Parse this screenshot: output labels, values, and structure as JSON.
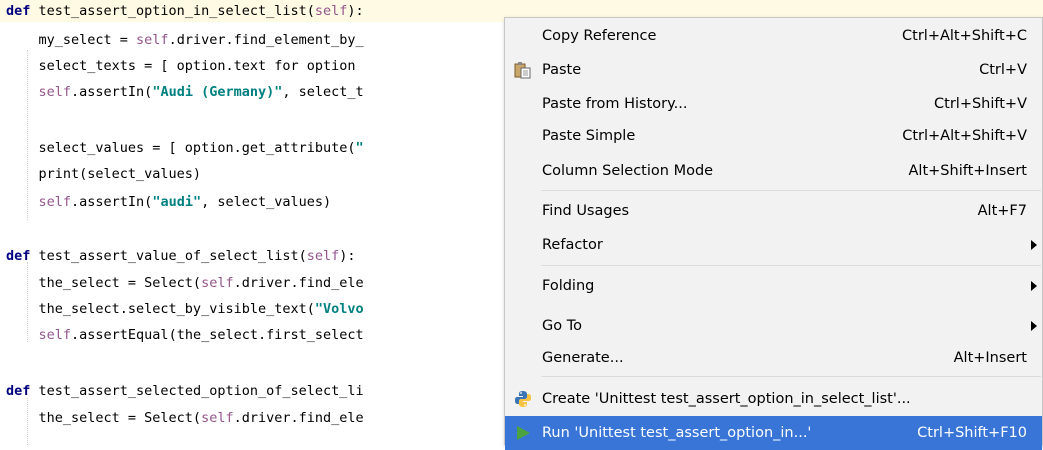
{
  "editor": {
    "lines": [
      [
        [
          "kw",
          "def "
        ],
        [
          "",
          "test_assert_option_in_select_list("
        ],
        [
          "self",
          "self"
        ],
        [
          "",
          "):"
        ]
      ],
      [
        [
          "",
          "    my_select = "
        ],
        [
          "self",
          "self"
        ],
        [
          "",
          ".driver.find_element_by_"
        ]
      ],
      [
        [
          "",
          "    select_texts = [ option.text for option "
        ]
      ],
      [
        [
          "",
          "    "
        ],
        [
          "self",
          "self"
        ],
        [
          "",
          ".assertIn("
        ],
        [
          "str",
          "\"Audi (Germany)\""
        ],
        [
          "",
          ", select_t"
        ]
      ],
      [],
      [
        [
          "",
          "    select_values = [ option.get_attribute("
        ],
        [
          "str",
          "\""
        ]
      ],
      [
        [
          "",
          "    print(select_values)"
        ]
      ],
      [
        [
          "",
          "    "
        ],
        [
          "self",
          "self"
        ],
        [
          "",
          ".assertIn("
        ],
        [
          "str",
          "\"audi\""
        ],
        [
          "",
          ", select_values)"
        ]
      ],
      [],
      [
        [
          "kw",
          "def "
        ],
        [
          "",
          "test_assert_value_of_select_list("
        ],
        [
          "self",
          "self"
        ],
        [
          "",
          "):"
        ]
      ],
      [
        [
          "",
          "    the_select = Select("
        ],
        [
          "self",
          "self"
        ],
        [
          "",
          ".driver.find_ele"
        ]
      ],
      [
        [
          "",
          "    the_select.select_by_visible_text("
        ],
        [
          "str",
          "\"Volvo"
        ]
      ],
      [
        [
          "",
          "    "
        ],
        [
          "self",
          "self"
        ],
        [
          "",
          ".assertEqual(the_select.first_select"
        ]
      ],
      [],
      [
        [
          "kw",
          "def "
        ],
        [
          "",
          "test_assert_selected_option_of_select_li"
        ]
      ],
      [
        [
          "",
          "    the_select = Select("
        ],
        [
          "self",
          "self"
        ],
        [
          "",
          ".driver.find_ele"
        ]
      ]
    ]
  },
  "menu": {
    "items": [
      {
        "name": "copy-reference-item",
        "label": "Copy Reference",
        "shortcut": "Ctrl+Alt+Shift+C"
      },
      {
        "name": "paste-item",
        "label": "Paste",
        "shortcut": "Ctrl+V",
        "icon": "paste-icon"
      },
      {
        "name": "paste-from-history-item",
        "label": "Paste from History...",
        "shortcut": "Ctrl+Shift+V"
      },
      {
        "name": "paste-simple-item",
        "label": "Paste Simple",
        "shortcut": "Ctrl+Alt+Shift+V"
      },
      {
        "name": "column-selection-mode-item",
        "label": "Column Selection Mode",
        "shortcut": "Alt+Shift+Insert"
      },
      {
        "name": "find-usages-item",
        "label": "Find Usages",
        "shortcut": "Alt+F7"
      },
      {
        "name": "refactor-item",
        "label": "Refactor",
        "submenu": true
      },
      {
        "name": "folding-item",
        "label": "Folding",
        "submenu": true
      },
      {
        "name": "go-to-item",
        "label": "Go To",
        "submenu": true
      },
      {
        "name": "generate-item",
        "label": "Generate...",
        "shortcut": "Alt+Insert"
      },
      {
        "name": "create-unittest-item",
        "label": "Create 'Unittest test_assert_option_in_select_list'...",
        "icon": "python-icon"
      },
      {
        "name": "run-unittest-item",
        "label": "Run 'Unittest test_assert_option_in...'",
        "shortcut": "Ctrl+Shift+F10",
        "icon": "run-icon",
        "selected": true
      }
    ]
  },
  "colors": {
    "selection": "#3875d7",
    "keyword": "#000080",
    "self": "#94558d",
    "string": "#008080",
    "current_line": "#fffae3",
    "run_icon": "#4aa340"
  }
}
